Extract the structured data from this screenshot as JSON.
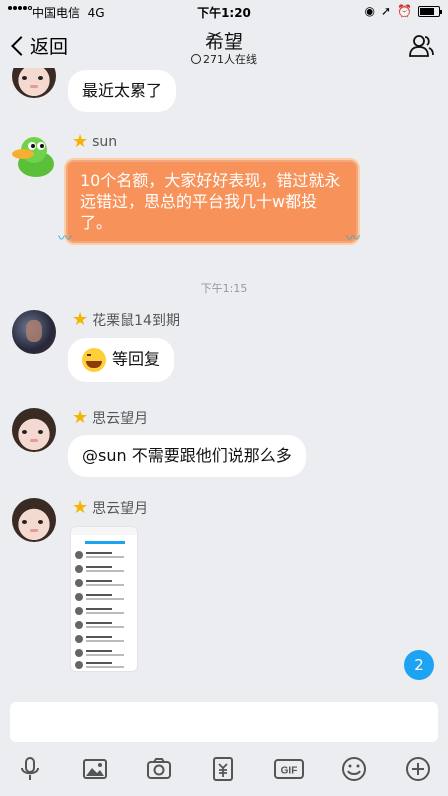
{
  "status_bar": {
    "carrier": "中国电信",
    "network": "4G",
    "time": "下午1:20"
  },
  "nav": {
    "back_label": "返回",
    "title": "希望",
    "online_count": "271人在线"
  },
  "messages": [
    {
      "sender": "",
      "text": "最近太累了"
    },
    {
      "sender": "sun",
      "text": "10个名额，大家好好表现，错过就永远错过，思总的平台我几十w都投了。"
    },
    {
      "timestamp": "下午1:15"
    },
    {
      "sender": "花栗鼠14到期",
      "text": "等回复"
    },
    {
      "sender": "思云望月",
      "text": "@sun 不需要跟他们说那么多"
    },
    {
      "sender": "思云望月",
      "attachment": "image"
    }
  ],
  "unread_badge": "2",
  "input": {
    "placeholder": ""
  },
  "toolbar": [
    "mic-icon",
    "image-icon",
    "camera-icon",
    "red-packet-icon",
    "gif-icon",
    "emoji-icon",
    "plus-icon"
  ],
  "colors": {
    "accent": "#1ca3f2",
    "orange_bubble": "#f7935a",
    "star": "#f5b400"
  }
}
